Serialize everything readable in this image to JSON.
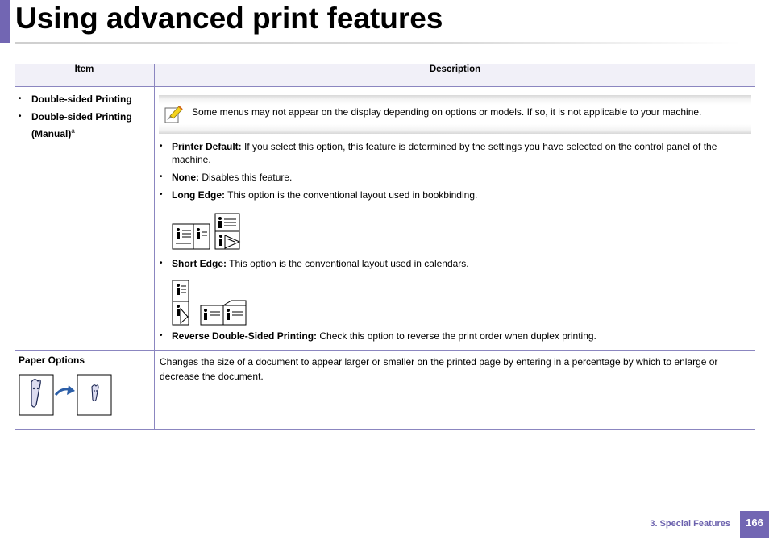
{
  "page": {
    "title": "Using advanced print features"
  },
  "table": {
    "header_item": "Item",
    "header_description": "Description",
    "row1": {
      "items": [
        "Double-sided Printing",
        "Double-sided Printing (Manual)"
      ],
      "footnote_marker": "a",
      "note_text": "Some menus may not appear on the display depending on options or models. If so, it is not applicable to your machine.",
      "options": [
        {
          "label": "Printer Default:",
          "text": " If you select this option, this feature is determined by the settings you have selected on the control panel of the machine."
        },
        {
          "label": "None:",
          "text": " Disables this feature."
        },
        {
          "label": "Long Edge:",
          "text": " This option is the conventional layout used in bookbinding."
        },
        {
          "label": "Short Edge:",
          "text": " This option is the conventional layout used in calendars."
        },
        {
          "label": "Reverse Double-Sided Printing:",
          "text": " Check this option to reverse the print order when duplex printing."
        }
      ]
    },
    "row2": {
      "item": "Paper Options",
      "description": "Changes the size of a document to appear larger or smaller on the printed page by entering in a percentage by which to enlarge or decrease the document."
    }
  },
  "icons": {
    "note": "note-pencil-icon",
    "long_edge": "long-edge-duplex-icon",
    "short_edge": "short-edge-duplex-icon",
    "paper_options": "scaling-carrot-icon"
  },
  "colors": {
    "accent": "#7266b3",
    "table_rule": "#8b86c0",
    "header_bg": "#f1f0f8",
    "arrow": "#2c5fa8"
  },
  "footer": {
    "section": "3.  Special Features",
    "page_number": "166"
  }
}
